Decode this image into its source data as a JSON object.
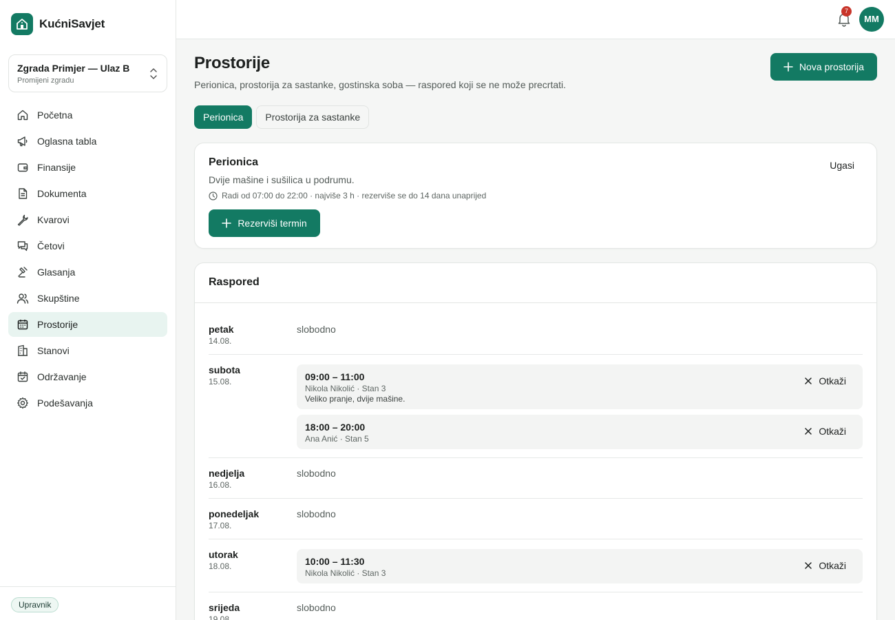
{
  "app": {
    "name": "KućniSavjet"
  },
  "building": {
    "name": "Zgrada Primjer — Ulaz B",
    "sub": "Promijeni zgradu"
  },
  "sidebar": {
    "items": [
      {
        "label": "Početna",
        "icon": "home-icon"
      },
      {
        "label": "Oglasna tabla",
        "icon": "megaphone-icon"
      },
      {
        "label": "Finansije",
        "icon": "wallet-icon"
      },
      {
        "label": "Dokumenta",
        "icon": "document-icon"
      },
      {
        "label": "Kvarovi",
        "icon": "wrench-icon"
      },
      {
        "label": "Četovi",
        "icon": "chat-icon"
      },
      {
        "label": "Glasanja",
        "icon": "gavel-icon"
      },
      {
        "label": "Skupštine",
        "icon": "users-icon"
      },
      {
        "label": "Prostorije",
        "icon": "calendar-icon",
        "active": true
      },
      {
        "label": "Stanovi",
        "icon": "building-icon"
      },
      {
        "label": "Održavanje",
        "icon": "calendar-check-icon"
      },
      {
        "label": "Podešavanja",
        "icon": "gear-icon"
      }
    ],
    "role": "Upravnik"
  },
  "topbar": {
    "notifications": "7",
    "avatar": "MM"
  },
  "page": {
    "title": "Prostorije",
    "subtitle": "Perionica, prostorija za sastanke, gostinska soba — raspored koji se ne može precrtati.",
    "new_button": "Nova prostorija",
    "tabs": [
      "Perionica",
      "Prostorija za sastanke"
    ]
  },
  "room": {
    "name": "Perionica",
    "description": "Dvije mašine i sušilica u podrumu.",
    "meta": "Radi od 07:00 do 22:00 · najviše 3 h · rezerviše se do 14 dana unaprijed",
    "toggle": "Ugasi",
    "reserve": "Rezerviši termin"
  },
  "schedule": {
    "title": "Raspored",
    "free_label": "slobodno",
    "cancel_label": "Otkaži",
    "days": [
      {
        "name": "petak",
        "date": "14.08.",
        "slots": []
      },
      {
        "name": "subota",
        "date": "15.08.",
        "slots": [
          {
            "time": "09:00 – 11:00",
            "who": "Nikola Nikolić · Stan 3",
            "note": "Veliko pranje, dvije mašine."
          },
          {
            "time": "18:00 – 20:00",
            "who": "Ana Anić · Stan 5",
            "note": ""
          }
        ]
      },
      {
        "name": "nedjelja",
        "date": "16.08.",
        "slots": []
      },
      {
        "name": "ponedeljak",
        "date": "17.08.",
        "slots": []
      },
      {
        "name": "utorak",
        "date": "18.08.",
        "slots": [
          {
            "time": "10:00 – 11:30",
            "who": "Nikola Nikolić · Stan 3",
            "note": ""
          }
        ]
      },
      {
        "name": "srijeda",
        "date": "19.08.",
        "slots": []
      }
    ]
  },
  "colors": {
    "accent": "#137a63",
    "badge": "#c8352a"
  }
}
